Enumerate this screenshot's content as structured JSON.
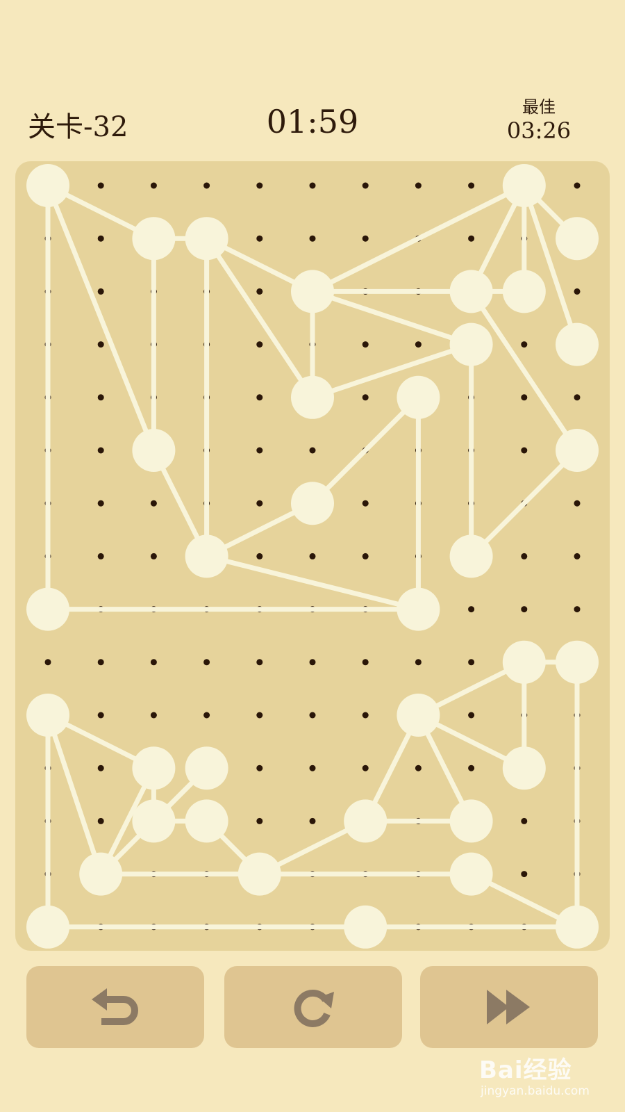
{
  "header": {
    "level": "关卡-32",
    "timer": "01:59",
    "best_label": "最佳",
    "best_time": "03:26"
  },
  "grid": {
    "cols": 11,
    "rows": 15
  },
  "nodes": [
    [
      0,
      0
    ],
    [
      2,
      1
    ],
    [
      3,
      1
    ],
    [
      5,
      2
    ],
    [
      9,
      0
    ],
    [
      10,
      1
    ],
    [
      8,
      2
    ],
    [
      9,
      2
    ],
    [
      10,
      3
    ],
    [
      8,
      3
    ],
    [
      5,
      4
    ],
    [
      7,
      4
    ],
    [
      2,
      5
    ],
    [
      10,
      5
    ],
    [
      5,
      6
    ],
    [
      3,
      7
    ],
    [
      8,
      7
    ],
    [
      0,
      8
    ],
    [
      7,
      8
    ],
    [
      9,
      9
    ],
    [
      10,
      9
    ],
    [
      0,
      10
    ],
    [
      7,
      10
    ],
    [
      2,
      11
    ],
    [
      3,
      11
    ],
    [
      9,
      11
    ],
    [
      2,
      12
    ],
    [
      3,
      12
    ],
    [
      6,
      12
    ],
    [
      8,
      12
    ],
    [
      1,
      13
    ],
    [
      4,
      13
    ],
    [
      8,
      13
    ],
    [
      0,
      14
    ],
    [
      6,
      14
    ],
    [
      10,
      14
    ]
  ],
  "edges": [
    [
      0,
      1
    ],
    [
      1,
      2
    ],
    [
      0,
      12
    ],
    [
      0,
      17
    ],
    [
      1,
      12
    ],
    [
      12,
      15
    ],
    [
      2,
      15
    ],
    [
      2,
      10
    ],
    [
      2,
      3
    ],
    [
      3,
      10
    ],
    [
      3,
      4
    ],
    [
      3,
      6
    ],
    [
      3,
      9
    ],
    [
      9,
      10
    ],
    [
      9,
      16
    ],
    [
      4,
      5
    ],
    [
      4,
      6
    ],
    [
      4,
      7
    ],
    [
      4,
      8
    ],
    [
      6,
      7
    ],
    [
      6,
      13
    ],
    [
      13,
      16
    ],
    [
      11,
      14
    ],
    [
      14,
      15
    ],
    [
      15,
      18
    ],
    [
      11,
      18
    ],
    [
      17,
      18
    ],
    [
      19,
      20
    ],
    [
      19,
      22
    ],
    [
      19,
      25
    ],
    [
      20,
      35
    ],
    [
      22,
      25
    ],
    [
      22,
      28
    ],
    [
      22,
      29
    ],
    [
      28,
      29
    ],
    [
      28,
      31
    ],
    [
      31,
      27
    ],
    [
      27,
      26
    ],
    [
      26,
      24
    ],
    [
      24,
      30
    ],
    [
      26,
      23
    ],
    [
      23,
      30
    ],
    [
      21,
      23
    ],
    [
      21,
      30
    ],
    [
      21,
      33
    ],
    [
      30,
      32
    ],
    [
      32,
      35
    ],
    [
      33,
      34
    ],
    [
      34,
      35
    ]
  ],
  "buttons": {
    "undo_icon": "undo-arrow-icon",
    "restart_icon": "restart-circular-arrow-icon",
    "skip_icon": "fast-forward-icon"
  },
  "colors": {
    "background": "#f6e8bd",
    "board": "#e6d39b",
    "node": "#f8f4da",
    "dot": "#2a1608",
    "button": "#dfc591",
    "icon": "#8c7a64"
  },
  "watermark": {
    "logo": "Bai经验",
    "url": "jingyan.baidu.com"
  }
}
